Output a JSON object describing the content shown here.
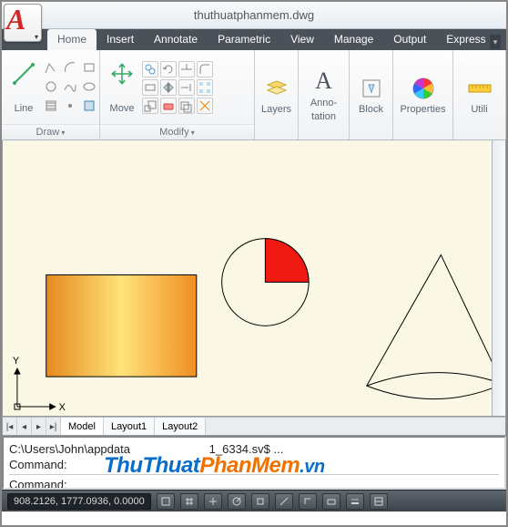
{
  "title": "thuthuatphanmem.dwg",
  "app_logo_letter": "A",
  "tabs": {
    "home": "Home",
    "insert": "Insert",
    "annotate": "Annotate",
    "parametric": "Parametric",
    "view": "View",
    "manage": "Manage",
    "output": "Output",
    "express": "Express Tools"
  },
  "ribbon": {
    "draw": {
      "title": "Draw",
      "line": "Line"
    },
    "modify": {
      "title": "Modify",
      "move": "Move"
    },
    "layers": {
      "title": "",
      "label": "Layers"
    },
    "annotation": {
      "label_l1": "Anno-",
      "label_l2": "tation"
    },
    "block": {
      "label": "Block"
    },
    "properties": {
      "label": "Properties"
    },
    "utilities": {
      "label": "Utili"
    }
  },
  "axes": {
    "x": "X",
    "y": "Y"
  },
  "layout": {
    "nav": {
      "first": "|◂",
      "prev": "◂",
      "next": "▸",
      "last": "▸|"
    },
    "tabs": {
      "model": "Model",
      "l1": "Layout1",
      "l2": "Layout2"
    }
  },
  "cmd": {
    "line1_pre": "C:\\Users\\John\\appdata",
    "line1_suf": "1_6334.sv$ ...",
    "prompt": "Command:"
  },
  "status": {
    "coords": "908.2126, 1777.0936, 0.0000"
  },
  "watermark": {
    "a": "ThuThuat",
    "b": "PhanMem",
    "c": ".vn"
  }
}
